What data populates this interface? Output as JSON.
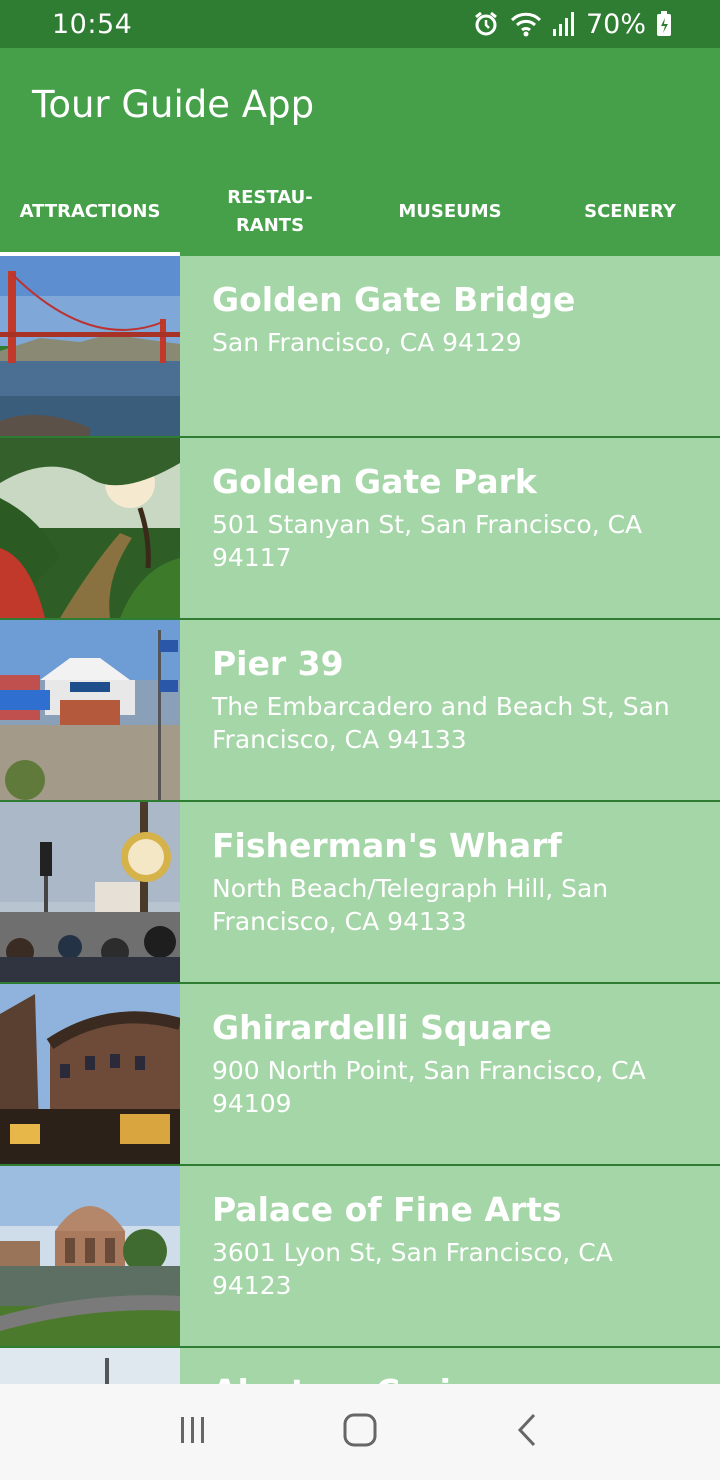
{
  "status_bar": {
    "time": "10:54",
    "battery": "70%",
    "icons": [
      "alarm-icon",
      "wifi-icon",
      "signal-icon",
      "battery-icon"
    ]
  },
  "app": {
    "title": "Tour Guide App"
  },
  "tabs": [
    {
      "label": "ATTRACTIONS",
      "active": true
    },
    {
      "label": "RESTAU-\nRANTS",
      "active": false
    },
    {
      "label": "MUSEUMS",
      "active": false
    },
    {
      "label": "SCENERY",
      "active": false
    }
  ],
  "attractions": [
    {
      "title": "Golden Gate Bridge",
      "address": "San Francisco, CA 94129",
      "image": "golden-gate-bridge-photo"
    },
    {
      "title": "Golden Gate Park",
      "address": "501 Stanyan St, San Francisco, CA 94117",
      "image": "golden-gate-park-photo"
    },
    {
      "title": "Pier 39",
      "address": "The Embarcadero and Beach St, San Francisco, CA 94133",
      "image": "pier-39-photo"
    },
    {
      "title": "Fisherman's Wharf",
      "address": "North Beach/Telegraph Hill, San Francisco, CA 94133",
      "image": "fishermans-wharf-photo"
    },
    {
      "title": "Ghirardelli Square",
      "address": "900 North Point, San Francisco, CA 94109",
      "image": "ghirardelli-square-photo"
    },
    {
      "title": "Palace of Fine Arts",
      "address": "3601 Lyon St, San Francisco, CA 94123",
      "image": "palace-of-fine-arts-photo"
    },
    {
      "title": "Alcatraz Cruises",
      "address": "",
      "image": "alcatraz-photo"
    }
  ],
  "nav_bar": {
    "icons": [
      "recent-apps-icon",
      "home-icon",
      "back-icon"
    ]
  },
  "colors": {
    "status_bar": "#2f7d32",
    "app_bar": "#45a049",
    "list_item_bg": "#a5d6a7",
    "divider": "#2f7d32",
    "text": "#ffffff"
  }
}
